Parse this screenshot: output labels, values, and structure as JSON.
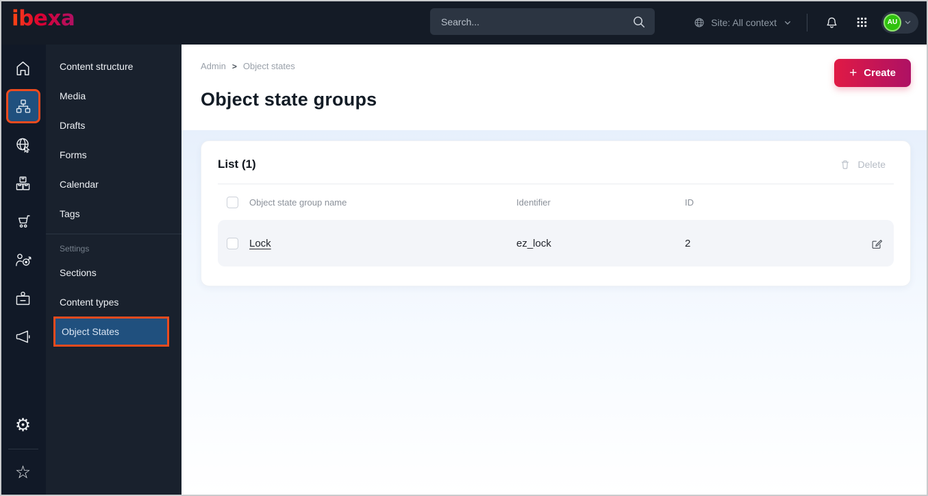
{
  "topbar": {
    "logo_text": "ibexa",
    "search_placeholder": "Search...",
    "site_label": "Site: All context",
    "avatar_initials": "AU"
  },
  "rail": {
    "icons": [
      "home",
      "content-structure",
      "site",
      "product-catalog",
      "commerce",
      "personalization",
      "corporate",
      "campaign",
      "settings",
      "bookmarks"
    ],
    "active": "content-structure",
    "settings_glyph": "⚙",
    "bookmarks_glyph": "☆"
  },
  "menu": {
    "items": [
      "Content structure",
      "Media",
      "Drafts",
      "Forms",
      "Calendar",
      "Tags"
    ],
    "section_label": "Settings",
    "settings_items": [
      "Sections",
      "Content types",
      "Object States"
    ],
    "active_item": "Object States"
  },
  "main": {
    "breadcrumb": {
      "parent": "Admin",
      "separator": ">",
      "current": "Object states"
    },
    "title": "Object state groups",
    "create_button": "Create",
    "create_plus": "+",
    "list": {
      "header": "List (1)",
      "delete_button": "Delete",
      "columns": [
        "Object state group name",
        "Identifier",
        "ID"
      ],
      "rows": [
        {
          "name": "Lock",
          "identifier": "ez_lock",
          "id": "2"
        }
      ]
    }
  },
  "colors": {
    "topbar_bg": "#141b26",
    "menu_bg": "#19212d",
    "active_blue": "#20507e",
    "annotation_orange": "#ee4b1e",
    "brand_gradient_start": "#ff4713",
    "brand_gradient_end": "#ae1164",
    "create_gradient_start": "#e01a45",
    "create_gradient_end": "#ae1164",
    "avatar_green": "#2fc20e",
    "content_bg_top": "#e7f0fc"
  }
}
